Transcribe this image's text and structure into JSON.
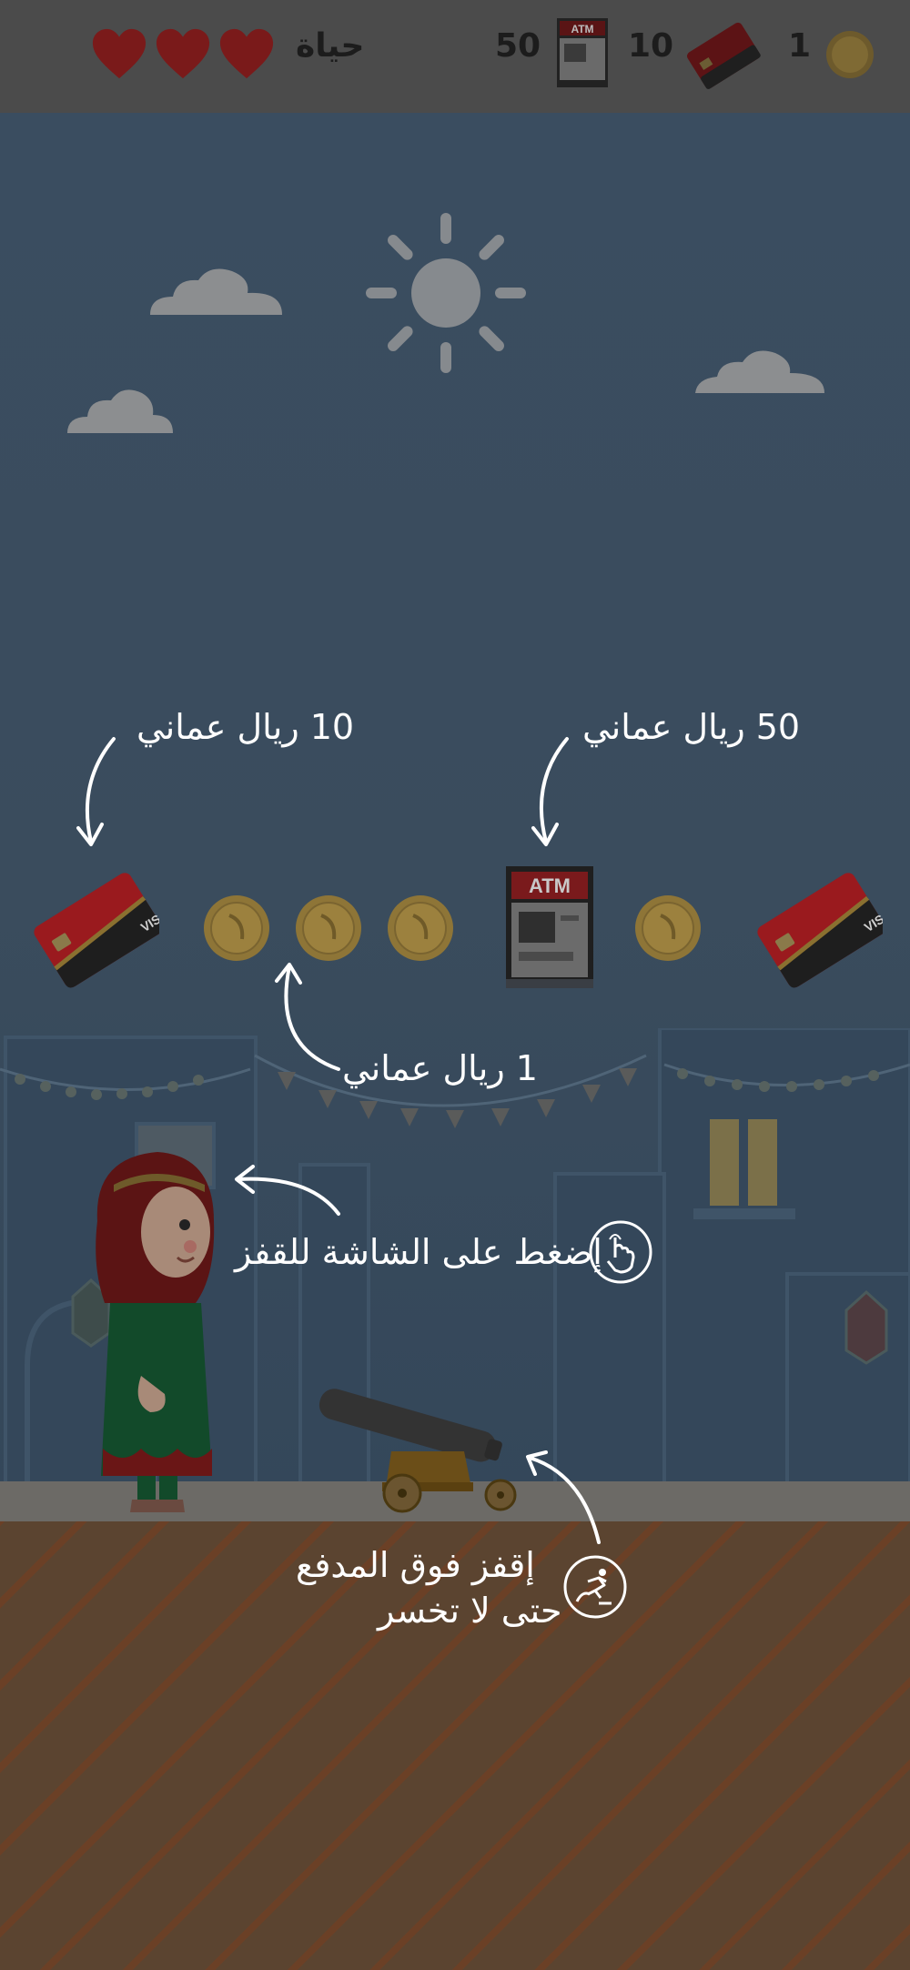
{
  "hud": {
    "coins_count": "1",
    "cards_count": "10",
    "atm_count": "50",
    "lives_label": "حياة",
    "lives": 3,
    "atm_text": "ATM"
  },
  "tutorial": {
    "card_value_label": "10 ريال عماني",
    "atm_value_label": "50 ريال عماني",
    "coin_value_label": "1 ريال عماني",
    "tap_hint": "إضغط على الشاشة للقفز",
    "cannon_hint_line1": "إقفز فوق المدفع",
    "cannon_hint_line2": "حتى لا تخسر"
  },
  "colors": {
    "hud_bg": "#4b4b4b",
    "heart": "#8a1c1c",
    "sky": "#3a4d5f",
    "coin": "#c9a241",
    "card_red": "#b81f24",
    "dirt": "#5b4430"
  },
  "icons": [
    "coin-icon",
    "card-icon",
    "atm-icon",
    "heart-icon",
    "sun-icon",
    "cloud-icon",
    "tap-hand-icon",
    "jump-icon",
    "cannon",
    "girl-character",
    "arrow-icon"
  ]
}
